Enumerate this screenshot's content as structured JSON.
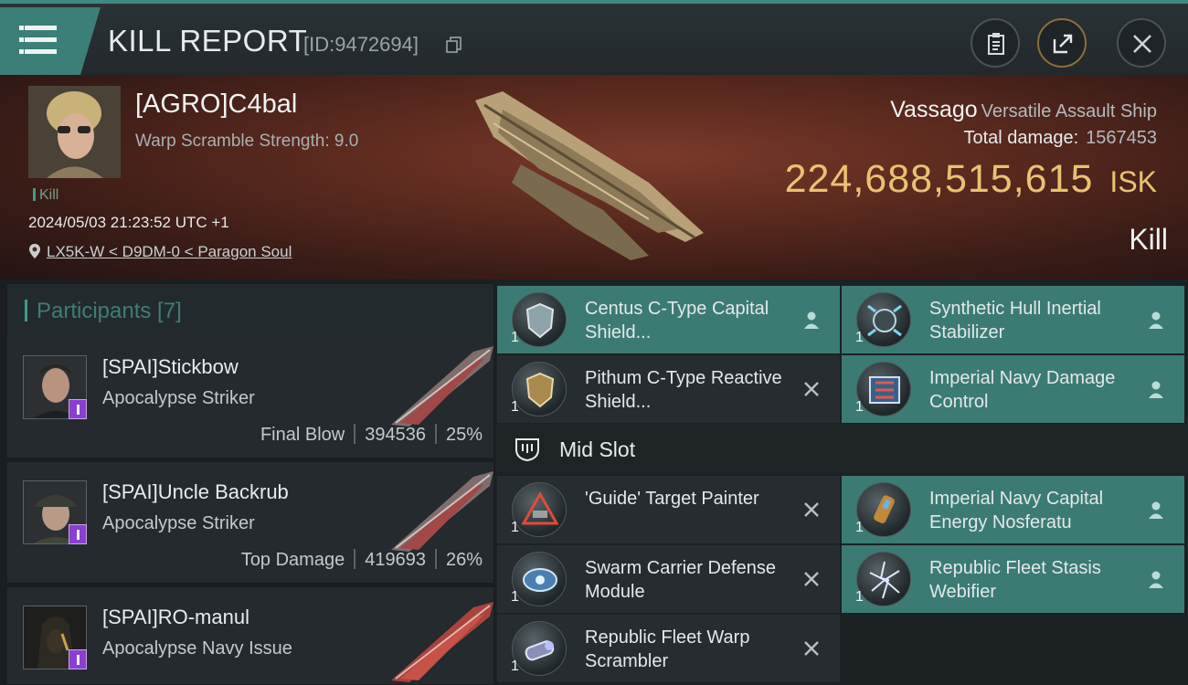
{
  "header": {
    "title": "KILL REPORT",
    "report_id": "[ID:9472694]"
  },
  "victim": {
    "name": "[AGRO]C4bal",
    "warp_scramble": "Warp Scramble Strength: 9.0",
    "kill_tag": "Kill",
    "time": "2024/05/03 21:23:52 UTC +1",
    "location": "LX5K-W < D9DM-0 < Paragon Soul"
  },
  "ship": {
    "name": "Vassago",
    "class": "Versatile Assault Ship",
    "total_damage_label": "Total damage:",
    "total_damage": "1567453",
    "isk_value": "224,688,515,615",
    "isk_unit": "ISK",
    "result": "Kill"
  },
  "participants": {
    "header": "Participants [7]",
    "items": [
      {
        "name": "[SPAI]Stickbow",
        "ship": "Apocalypse Striker",
        "role": "Final Blow",
        "damage": "394536",
        "percent": "25%"
      },
      {
        "name": "[SPAI]Uncle Backrub",
        "ship": "Apocalypse Striker",
        "role": "Top Damage",
        "damage": "419693",
        "percent": "26%"
      },
      {
        "name": "[SPAI]RO-manul",
        "ship": "Apocalypse Navy Issue",
        "role": "",
        "damage": "",
        "percent": ""
      }
    ]
  },
  "fitting": {
    "low_modules": [
      {
        "name": "Centus C-Type Capital Shield...",
        "qty": "1",
        "status": "person-icon",
        "highlight": true
      },
      {
        "name": "Synthetic Hull Inertial Stabilizer",
        "qty": "1",
        "status": "person-icon",
        "highlight": true
      },
      {
        "name": "Pithum C-Type Reactive Shield...",
        "qty": "1",
        "status": "x-icon",
        "highlight": false
      },
      {
        "name": "Imperial Navy Damage Control",
        "qty": "1",
        "status": "person-icon",
        "highlight": true
      }
    ],
    "mid_slot_title": "Mid Slot",
    "mid_modules": [
      {
        "name": "'Guide' Target Painter",
        "qty": "1",
        "status": "x-icon",
        "highlight": false
      },
      {
        "name": "Imperial Navy Capital Energy Nosferatu",
        "qty": "1",
        "status": "person-icon",
        "highlight": true
      },
      {
        "name": "Swarm Carrier Defense Module",
        "qty": "1",
        "status": "x-icon",
        "highlight": false
      },
      {
        "name": "Republic Fleet Stasis Webifier",
        "qty": "1",
        "status": "person-icon",
        "highlight": true
      },
      {
        "name": "Republic Fleet Warp Scrambler",
        "qty": "1",
        "status": "x-icon",
        "highlight": false
      }
    ]
  },
  "colors": {
    "accent_teal": "#3b7b74",
    "isk_gold": "#e9c272",
    "badge_purple": "#8a3fd1"
  }
}
